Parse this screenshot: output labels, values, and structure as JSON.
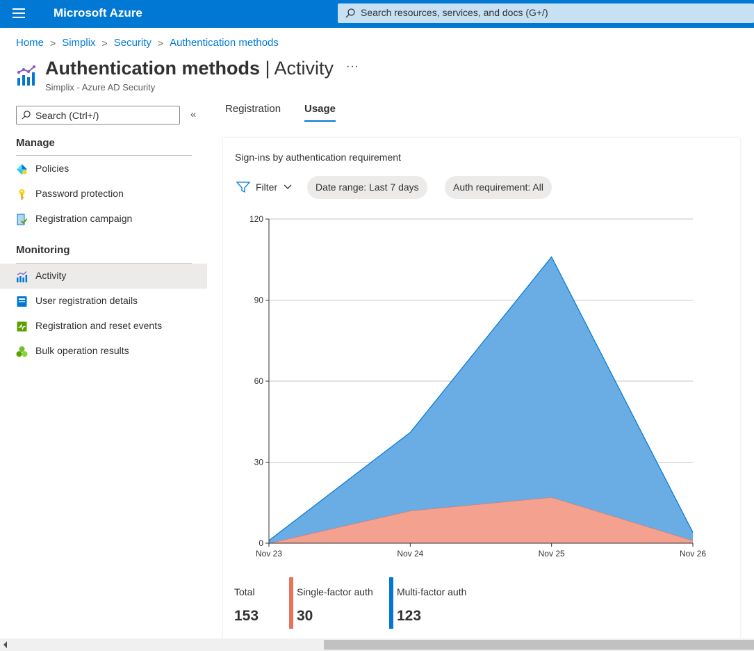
{
  "topbar": {
    "brand": "Microsoft Azure",
    "search_placeholder": "Search resources, services, and docs (G+/)"
  },
  "breadcrumb": [
    "Home",
    "Simplix",
    "Security",
    "Authentication methods"
  ],
  "page": {
    "title_bold": "Authentication methods",
    "title_sep": " | ",
    "title_light": "Activity",
    "more": "···",
    "subtitle": "Simplix - Azure AD Security"
  },
  "sidebar": {
    "search_placeholder": "Search (Ctrl+/)",
    "collapse": "«",
    "manage_header": "Manage",
    "manage_items": [
      {
        "label": "Policies",
        "icon": "policies-icon"
      },
      {
        "label": "Password protection",
        "icon": "key-icon"
      },
      {
        "label": "Registration campaign",
        "icon": "registration-campaign-icon"
      }
    ],
    "monitoring_header": "Monitoring",
    "monitoring_items": [
      {
        "label": "Activity",
        "icon": "activity-chart-icon",
        "active": true
      },
      {
        "label": "User registration details",
        "icon": "user-registration-icon"
      },
      {
        "label": "Registration and reset events",
        "icon": "events-icon"
      },
      {
        "label": "Bulk operation results",
        "icon": "bulk-operation-icon"
      }
    ]
  },
  "tabs": [
    {
      "label": "Registration",
      "active": false
    },
    {
      "label": "Usage",
      "active": true
    }
  ],
  "card": {
    "title": "Sign-ins by authentication requirement",
    "filter_label": "Filter",
    "date_range": "Date range: Last 7 days",
    "auth_requirement": "Auth requirement: All"
  },
  "chart_data": {
    "type": "area",
    "stacked": true,
    "categories": [
      "Nov 23",
      "Nov 24",
      "Nov 25",
      "Nov 26"
    ],
    "y_ticks": [
      0,
      30,
      60,
      90,
      120
    ],
    "ylim": [
      0,
      120
    ],
    "grid": true,
    "series": [
      {
        "name": "Single-factor auth",
        "values": [
          0,
          12,
          17,
          1
        ],
        "color": "#f4a190",
        "stroke": "#e8735a"
      },
      {
        "name": "Multi-factor auth",
        "values": [
          1,
          29,
          89,
          3
        ],
        "color": "#69ade4",
        "stroke": "#0078d4"
      }
    ]
  },
  "legend": {
    "total_label": "Total",
    "total_value": "153",
    "single_label": "Single-factor auth",
    "single_value": "30",
    "single_color": "#e8735a",
    "multi_label": "Multi-factor auth",
    "multi_value": "123",
    "multi_color": "#0078d4"
  }
}
